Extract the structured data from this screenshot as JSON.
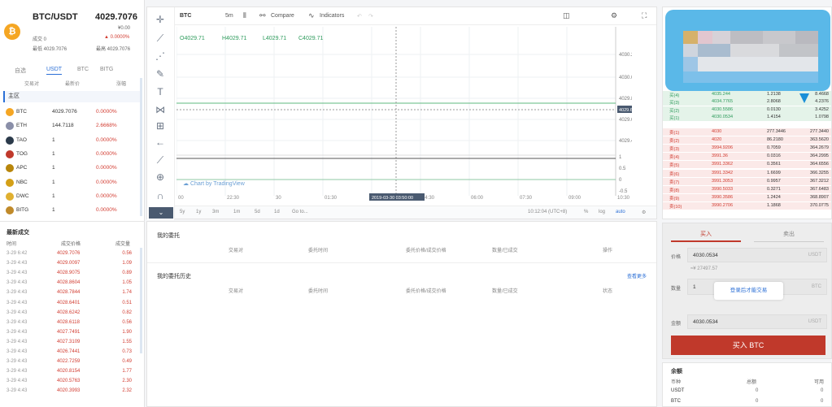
{
  "ticker": {
    "pair": "BTC/USDT",
    "price": "4029.7076",
    "price_sub": "¥0.00",
    "volume_label": "成交 0",
    "change": "▲ 0.0000%",
    "low_label": "最低 4029.7076",
    "high_label": "最高 4029.7076",
    "coin_symbol": "₿"
  },
  "market_tabs": [
    "自选",
    "USDT",
    "BTC",
    "BITG"
  ],
  "market_headers": {
    "pair": "交易对",
    "price": "最新价",
    "change": "涨幅"
  },
  "section_label": "主区",
  "markets": [
    {
      "name": "BTC",
      "price": "4029.7076",
      "change": "0.0000%",
      "color": "#f5a623"
    },
    {
      "name": "ETH",
      "price": "144.7118",
      "change": "2.6668%",
      "color": "#8a8fa8"
    },
    {
      "name": "TAO",
      "price": "1",
      "change": "0.0000%",
      "color": "#2b3a4a"
    },
    {
      "name": "TOG",
      "price": "1",
      "change": "0.0000%",
      "color": "#c0392b"
    },
    {
      "name": "APC",
      "price": "1",
      "change": "0.0000%",
      "color": "#b8860b"
    },
    {
      "name": "NBC",
      "price": "1",
      "change": "0.0000%",
      "color": "#d4a017"
    },
    {
      "name": "DWC",
      "price": "1",
      "change": "0.0000%",
      "color": "#e0b030"
    },
    {
      "name": "BITG",
      "price": "1",
      "change": "0.0000%",
      "color": "#c08a2a"
    }
  ],
  "recent_trades": {
    "title": "最新成交",
    "headers": {
      "time": "时间",
      "price": "成交价格",
      "amount": "成交量"
    },
    "rows": [
      {
        "time": "3-29 6:42",
        "price": "4029.7076",
        "amount": "0.56"
      },
      {
        "time": "3-29 4:43",
        "price": "4029.0097",
        "amount": "1.09"
      },
      {
        "time": "3-29 4:43",
        "price": "4028.9075",
        "amount": "0.89"
      },
      {
        "time": "3-29 4:43",
        "price": "4028.8604",
        "amount": "1.05"
      },
      {
        "time": "3-29 4:43",
        "price": "4028.7844",
        "amount": "1.74"
      },
      {
        "time": "3-29 4:43",
        "price": "4028.6401",
        "amount": "0.51"
      },
      {
        "time": "3-29 4:43",
        "price": "4028.6242",
        "amount": "0.82"
      },
      {
        "time": "3-29 4:43",
        "price": "4028.6118",
        "amount": "0.56"
      },
      {
        "time": "3-29 4:43",
        "price": "4027.7491",
        "amount": "1.90"
      },
      {
        "time": "3-29 4:43",
        "price": "4027.3109",
        "amount": "1.55"
      },
      {
        "time": "3-29 4:43",
        "price": "4026.7441",
        "amount": "0.73"
      },
      {
        "time": "3-29 4:43",
        "price": "4022.7259",
        "amount": "0.49"
      },
      {
        "time": "3-29 4:43",
        "price": "4020.8154",
        "amount": "1.77"
      },
      {
        "time": "3-29 4:43",
        "price": "4020.5763",
        "amount": "2.30"
      },
      {
        "time": "3-29 4:43",
        "price": "4020.3993",
        "amount": "2.32"
      }
    ]
  },
  "chart_toolbar": {
    "symbol": "BTC",
    "interval": "5m",
    "compare": "Compare",
    "indicators": "Indicators"
  },
  "ohlc": {
    "open": "O4029.71",
    "high": "H4029.71",
    "low": "L4029.71",
    "close": "C4029.71"
  },
  "chart_data": {
    "type": "line",
    "price_ticks": [
      "4030.20",
      "4030.00",
      "4029.80",
      "4029.60",
      "4029.40"
    ],
    "last_price_label": "4029.62",
    "volume_ticks": [
      "1",
      "0.5",
      "0",
      "-0.5"
    ],
    "time_ticks": [
      "00",
      "22:30",
      "30",
      "01:30",
      "03",
      "04:30",
      "06:00",
      "07:30",
      "09:00",
      "10:30"
    ],
    "crosshair_label": "2019-03-30 03:50:00",
    "attribution": "Chart by TradingView"
  },
  "timebar": {
    "ranges": [
      "5y",
      "1y",
      "3m",
      "1m",
      "5d",
      "1d",
      "Go to..."
    ],
    "clock": "10:12:04 (UTC+8)",
    "pct": "%",
    "log": "log",
    "auto": "auto"
  },
  "my_orders": {
    "title": "我的委托",
    "cols": [
      "交易对",
      "委托时间",
      "委托价格/成交价格",
      "数量/已成交",
      "操作"
    ]
  },
  "order_history": {
    "title": "我的委托历史",
    "more": "查看更多",
    "cols": [
      "交易对",
      "委托时间",
      "委托价格/成交价格",
      "数量/已成交",
      "状态"
    ]
  },
  "orderbook": {
    "buys": [
      {
        "label": "买(4)",
        "price": "4035.244",
        "amount": "1.2138",
        "total": "8.4668"
      },
      {
        "label": "买(3)",
        "price": "4034.7765",
        "amount": "2.8068",
        "total": "4.2376"
      },
      {
        "label": "买(2)",
        "price": "4030.5586",
        "amount": "0.0130",
        "total": "3.4252"
      },
      {
        "label": "买(1)",
        "price": "4030.0534",
        "amount": "1.4154",
        "total": "1.0798"
      }
    ],
    "sells": [
      {
        "label": "卖(1)",
        "price": "4030",
        "amount": "277.3446",
        "total": "277.3440"
      },
      {
        "label": "卖(2)",
        "price": "4020",
        "amount": "86.2180",
        "total": "363.5620"
      },
      {
        "label": "卖(3)",
        "price": "3994.9206",
        "amount": "0.7059",
        "total": "364.2679"
      },
      {
        "label": "卖(4)",
        "price": "3991.36",
        "amount": "0.0316",
        "total": "364.2995"
      },
      {
        "label": "卖(5)",
        "price": "3991.3362",
        "amount": "0.3561",
        "total": "364.6556"
      },
      {
        "label": "卖(6)",
        "price": "3991.3342",
        "amount": "1.6699",
        "total": "366.3255"
      },
      {
        "label": "卖(7)",
        "price": "3991.3053",
        "amount": "0.9957",
        "total": "367.3212"
      },
      {
        "label": "卖(8)",
        "price": "3990.5033",
        "amount": "0.3271",
        "total": "367.6483"
      },
      {
        "label": "卖(9)",
        "price": "3990.3586",
        "amount": "1.2424",
        "total": "368.8907"
      },
      {
        "label": "卖(10)",
        "price": "3990.2706",
        "amount": "1.1868",
        "total": "370.0775"
      }
    ]
  },
  "trade_form": {
    "buy_tab": "买入",
    "sell_tab": "卖出",
    "price_label": "价格",
    "price_value": "4030.0534",
    "price_unit": "USDT",
    "price_cny": "≈¥ 27497.57",
    "qty_label": "数量",
    "qty_value": "1",
    "qty_unit": "BTC",
    "login_prompt": "登录后才能交易",
    "total_label": "金额",
    "total_value": "4030.0534",
    "total_unit": "USDT",
    "buy_button": "买入 BTC"
  },
  "balance": {
    "title": "余额",
    "headers": [
      "币种",
      "总额",
      "可用"
    ],
    "rows": [
      {
        "coin": "USDT",
        "total": "0",
        "avail": "0"
      },
      {
        "coin": "BTC",
        "total": "0",
        "avail": "0"
      }
    ]
  },
  "colors": {
    "accent": "#2b6fd6",
    "up": "#2e9b5c",
    "down": "#d23c31",
    "buy_button": "#c0392b"
  }
}
